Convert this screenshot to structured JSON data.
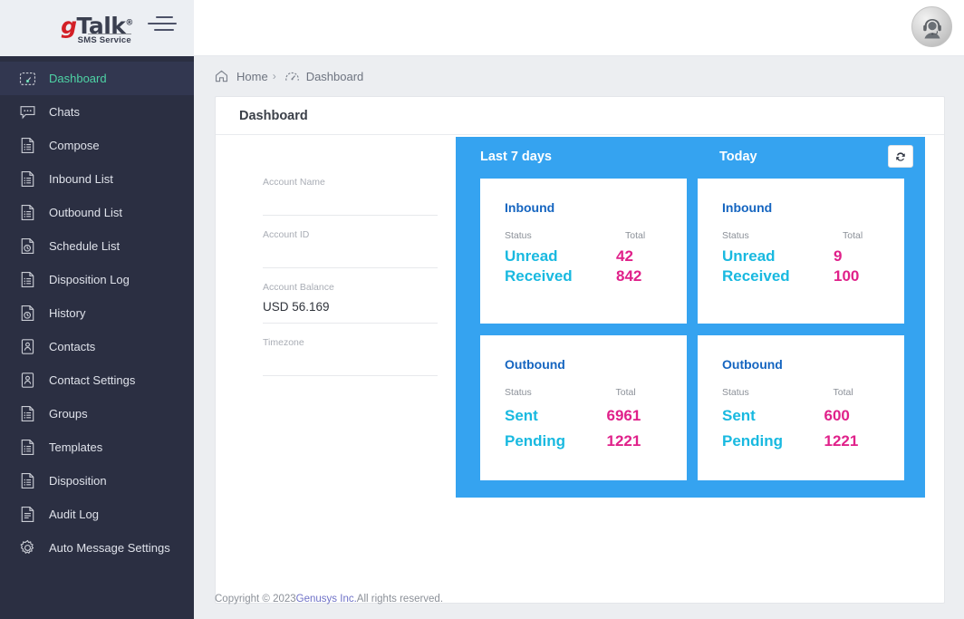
{
  "brand": {
    "logo_main_g": "g",
    "logo_main_talk": "Talk",
    "logo_registered": "®",
    "logo_subtitle": "SMS Service",
    "menu_icon": "hamburger-menu-icon"
  },
  "sidebar": {
    "items": [
      {
        "label": "Dashboard",
        "icon": "speedometer-icon",
        "active": true
      },
      {
        "label": "Chats",
        "icon": "chat-bubble-icon",
        "active": false
      },
      {
        "label": "Compose",
        "icon": "document-list-icon",
        "active": false
      },
      {
        "label": "Inbound List",
        "icon": "document-list-icon",
        "active": false
      },
      {
        "label": "Outbound List",
        "icon": "document-list-icon",
        "active": false
      },
      {
        "label": "Schedule List",
        "icon": "document-clock-icon",
        "active": false
      },
      {
        "label": "Disposition Log",
        "icon": "document-list-icon",
        "active": false
      },
      {
        "label": "History",
        "icon": "document-clock-icon",
        "active": false
      },
      {
        "label": "Contacts",
        "icon": "contact-card-icon",
        "active": false
      },
      {
        "label": "Contact Settings",
        "icon": "contact-card-icon",
        "active": false
      },
      {
        "label": "Groups",
        "icon": "document-list-icon",
        "active": false
      },
      {
        "label": "Templates",
        "icon": "document-list-icon",
        "active": false
      },
      {
        "label": "Disposition",
        "icon": "document-list-icon",
        "active": false
      },
      {
        "label": "Audit Log",
        "icon": "document-text-icon",
        "active": false
      },
      {
        "label": "Auto Message Settings",
        "icon": "gear-icon",
        "active": false
      }
    ]
  },
  "topbar": {
    "avatar_icon": "agent-headset-avatar"
  },
  "breadcrumb": {
    "home_icon": "home-icon",
    "home_label": "Home",
    "separator": "›",
    "current_icon": "speedometer-icon",
    "current_label": "Dashboard"
  },
  "panel": {
    "title": "Dashboard"
  },
  "account": {
    "rows": [
      {
        "label": "Account Name",
        "value": ""
      },
      {
        "label": "Account ID",
        "value": ""
      },
      {
        "label": "Account Balance",
        "value": "USD 56.169"
      },
      {
        "label": "Timezone",
        "value": ""
      }
    ]
  },
  "stats": {
    "columns": [
      "Last 7 days",
      "Today"
    ],
    "refresh_icon": "refresh-sync-icon",
    "col_headers": {
      "status": "Status",
      "total": "Total"
    },
    "cards": [
      {
        "title": "Inbound",
        "period": "Last 7 days",
        "rows": [
          {
            "status": "Unread",
            "total": "42"
          },
          {
            "status": "Received",
            "total": "842"
          }
        ]
      },
      {
        "title": "Inbound",
        "period": "Today",
        "rows": [
          {
            "status": "Unread",
            "total": "9"
          },
          {
            "status": "Received",
            "total": "100"
          }
        ]
      },
      {
        "title": "Outbound",
        "period": "Last 7 days",
        "rows": [
          {
            "status": "Sent",
            "total": "6961"
          },
          {
            "status": "Pending",
            "total": "1221"
          }
        ]
      },
      {
        "title": "Outbound",
        "period": "Today",
        "rows": [
          {
            "status": "Sent",
            "total": "600"
          },
          {
            "status": "Pending",
            "total": "1221"
          }
        ]
      }
    ]
  },
  "footer": {
    "prefix": "Copyright © 2023 ",
    "company": "Genusys Inc.",
    "suffix": " All rights reserved."
  },
  "colors": {
    "sidebar_bg": "#2b2f42",
    "sidebar_active_bg": "#323750",
    "sidebar_active_text": "#4ed3a5",
    "stats_panel_blue": "#35a3f0",
    "card_title_blue": "#1565c0",
    "status_cyan": "#19b9e0",
    "total_magenta": "#e0218a",
    "footer_link": "#6f72c7"
  }
}
